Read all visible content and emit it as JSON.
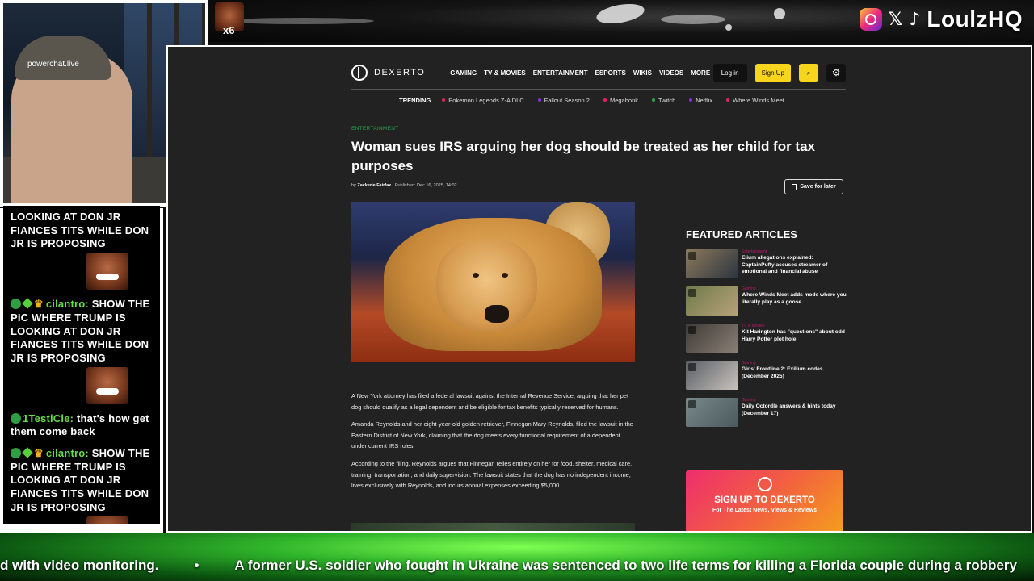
{
  "overlay": {
    "emote_count": "x6",
    "brand": "LoulzHQ",
    "social_icons": [
      "instagram-icon",
      "x-icon",
      "tiktok-icon"
    ]
  },
  "webcam": {
    "cap_text": "powerchat.live"
  },
  "chat": {
    "messages": [
      {
        "user": "",
        "text": "LOOKING AT DON JR FIANCES TITS WHILE DON JR IS PROPOSING",
        "emote": true
      },
      {
        "user": "cilantro:",
        "text": "SHOW THE PIC WHERE TRUMP IS LOOKING AT DON JR FIANCES TITS WHILE DON JR IS PROPOSING",
        "emote": true
      },
      {
        "user": "1TestiCle:",
        "text": "that's how get them come back",
        "emote": false
      },
      {
        "user": "cilantro:",
        "text": "SHOW THE PIC WHERE TRUMP IS LOOKING AT DON JR FIANCES TITS WHILE DON JR IS PROPOSING",
        "emote": true
      }
    ]
  },
  "site": {
    "logo": "DEXERTO",
    "nav": [
      "GAMING",
      "TV & MOVIES",
      "ENTERTAINMENT",
      "ESPORTS",
      "WIKIS",
      "VIDEOS",
      "MORE"
    ],
    "login": "Log in",
    "signup": "Sign Up",
    "trending_label": "TRENDING",
    "trending": [
      {
        "label": "Pokemon Legends Z-A DLC",
        "color": "#e0245e"
      },
      {
        "label": "Fallout Season 2",
        "color": "#8a2be2"
      },
      {
        "label": "Megabonk",
        "color": "#e0245e"
      },
      {
        "label": "Twitch",
        "color": "#2aa24f"
      },
      {
        "label": "Netflix",
        "color": "#8a2be2"
      },
      {
        "label": "Where Winds Meet",
        "color": "#e0245e"
      }
    ]
  },
  "article": {
    "category": "ENTERTAINMENT",
    "title": "Woman sues IRS arguing her dog should be treated as her child for tax purposes",
    "by": "by",
    "author": "Zackerie Fairfax",
    "published": "Published: Dec 16, 2025, 14:02",
    "save_label": "Save for later",
    "paragraphs": [
      "A New York attorney has filed a federal lawsuit against the Internal Revenue Service, arguing that her pet dog should qualify as a legal dependent and be eligible for tax benefits typically reserved for humans.",
      "Amanda Reynolds and her eight-year-old golden retriever, Finnegan Mary Reynolds, filed the lawsuit in the Eastern District of New York, claiming that the dog meets every functional requirement of a dependent under current IRS rules.",
      "According to the filing, Reynolds argues that Finnegan relies entirely on her for food, shelter, medical care, training, transportation, and daily supervision. The lawsuit states that the dog has no independent income, lives exclusively with Reynolds, and incurs annual expenses exceeding $5,000."
    ]
  },
  "featured": {
    "title": "FEATURED ARTICLES",
    "items": [
      {
        "category": "Entertainment",
        "text": "Elium allegations explained: CaptainPuffy accuses streamer of emotional and financial abuse",
        "thumb": "#8d7a5c"
      },
      {
        "category": "Gaming",
        "text": "Where Winds Meet adds mode where you literally play as a goose",
        "thumb": "#6e7a4a"
      },
      {
        "category": "TV & Movies",
        "text": "Kit Harington has \"questions\" about odd Harry Potter plot hole",
        "thumb": "#3e3a36"
      },
      {
        "category": "Gaming",
        "text": "Girls' Frontline 2: Exilium codes (December 2025)",
        "thumb": "#5a5e66"
      },
      {
        "category": "Gaming",
        "text": "Daily Octordle answers & hints today (December 17)",
        "thumb": "#7a8a8c"
      }
    ]
  },
  "signup_card": {
    "title": "SIGN UP TO DEXERTO",
    "subtitle": "For The Latest News, Views & Reviews"
  },
  "ticker": {
    "items": [
      "d with video monitoring.",
      "A former U.S. soldier who fought in Ukraine was sentenced to two life terms for killing a Florida couple during a robbery"
    ]
  }
}
